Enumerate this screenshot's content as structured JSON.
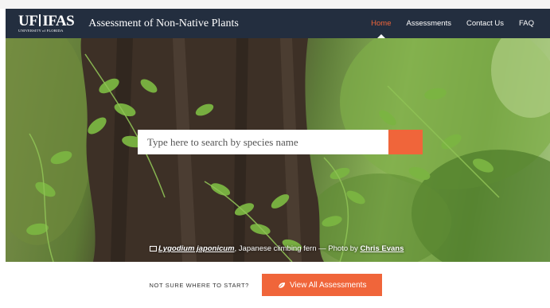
{
  "header": {
    "logo_main_left": "UF",
    "logo_main_right": "IFAS",
    "logo_sub": "UNIVERSITY of FLORIDA",
    "site_title": "Assessment of Non-Native Plants",
    "nav": [
      {
        "label": "Home",
        "active": true
      },
      {
        "label": "Assessments",
        "active": false
      },
      {
        "label": "Contact Us",
        "active": false
      },
      {
        "label": "FAQ",
        "active": false
      }
    ]
  },
  "search": {
    "placeholder": "Type here to search by species name",
    "button_icon": "search-icon"
  },
  "hero_caption": {
    "scientific_name": "Lygodium japonicum",
    "common_text": ", Japanese climbing fern — Photo by ",
    "author": "Chris Evans",
    "icon": "camera-icon"
  },
  "cta": {
    "prompt": "NOT SURE WHERE TO START?",
    "button_label": "View All Assessments",
    "button_icon": "leaf-icon"
  },
  "colors": {
    "nav_bg": "#232e3f",
    "accent": "#f0653a"
  }
}
